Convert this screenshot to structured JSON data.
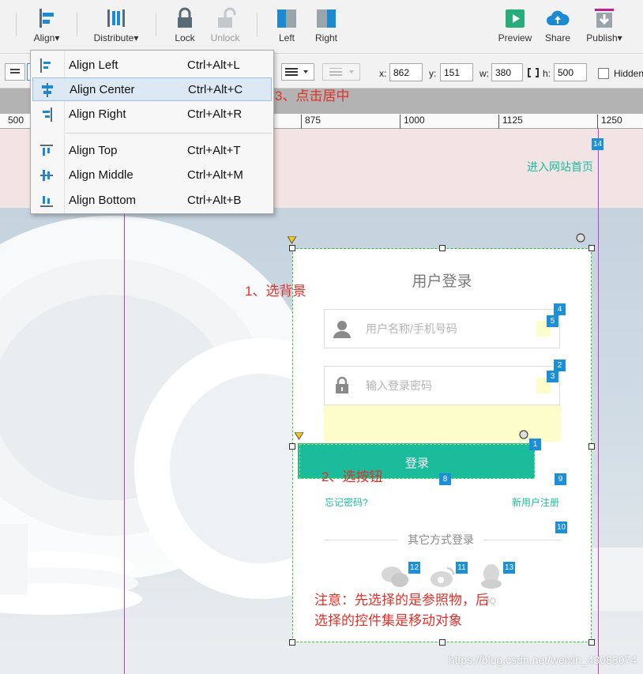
{
  "toolbar": {
    "align": "Align",
    "distribute": "Distribute",
    "lock": "Lock",
    "unlock": "Unlock",
    "left": "Left",
    "right": "Right",
    "preview": "Preview",
    "share": "Share",
    "publish": "Publish",
    "dropdown_arrow": "▾"
  },
  "format": {
    "x_label": "x:",
    "x_value": "862",
    "y_label": "y:",
    "y_value": "151",
    "w_label": "w:",
    "w_value": "380",
    "h_label": "h:",
    "h_value": "500",
    "hidden_label": "Hidden"
  },
  "ruler": {
    "ticks": [
      "500",
      "875",
      "1000",
      "1125",
      "1250"
    ]
  },
  "align_menu": {
    "items": [
      {
        "label": "Align Left",
        "shortcut": "Ctrl+Alt+L"
      },
      {
        "label": "Align Center",
        "shortcut": "Ctrl+Alt+C"
      },
      {
        "label": "Align Right",
        "shortcut": "Ctrl+Alt+R"
      },
      {
        "label": "Align Top",
        "shortcut": "Ctrl+Alt+T"
      },
      {
        "label": "Align Middle",
        "shortcut": "Ctrl+Alt+M"
      },
      {
        "label": "Align Bottom",
        "shortcut": "Ctrl+Alt+B"
      }
    ]
  },
  "annotations": {
    "step1": "1、选背景",
    "step2": "2、选按钮",
    "step3": "3、点击居中",
    "note_line1": "注意：先选择的是参照物，后",
    "note_line2": "选择的控件集是移动对象"
  },
  "page": {
    "home_link": "进入网站首页",
    "login_title": "用户登录",
    "username_placeholder": "用户名称/手机号码",
    "password_placeholder": "输入登录密码",
    "login_button": "登录",
    "forgot_password": "忘记密码?",
    "register": "新用户注册",
    "other_login": "其它方式登录",
    "qq_label": "QQ"
  },
  "badges": [
    "1",
    "2",
    "3",
    "4",
    "5",
    "8",
    "9",
    "10",
    "11",
    "12",
    "13",
    "14"
  ],
  "watermark": "https://blog.csdn.net/weixin_43083074",
  "colors": {
    "accent_green": "#1abc9c",
    "badge_blue": "#1d8fd6",
    "guide_magenta": "#c936e0",
    "note_red": "#e0312a"
  }
}
